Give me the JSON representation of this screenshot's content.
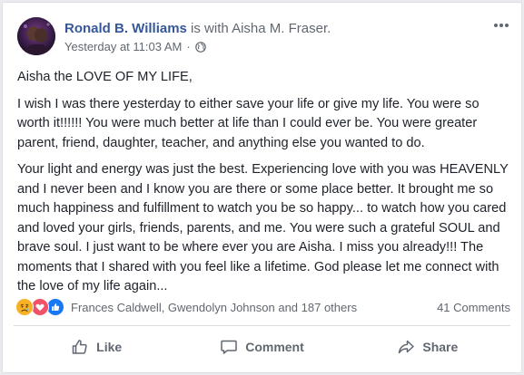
{
  "post": {
    "author": "Ronald B. Williams",
    "with_text": " is with ",
    "tagged": "Aisha M. Fraser.",
    "timestamp": "Yesterday at 11:03 AM",
    "separator": "·",
    "privacy_icon": "globe-icon",
    "more_icon": "more-options-icon",
    "paragraphs": [
      "Aisha the LOVE OF MY LIFE,",
      "I wish I was there yesterday to either save your life or give my life. You were so worth it!!!!!! You were much better at life than I could ever be. You were greater parent, friend, daughter, teacher, and anything else you wanted to do.",
      "Your light and energy was just the best. Experiencing love with you was HEAVENLY and I never been and I know you are there or some place better. It brought me so much happiness and fulfillment to watch you be so happy... to watch how you cared and loved your girls, friends, parents, and me. You were such a grateful SOUL and brave soul. I just want to be where ever you are Aisha. I miss you already!!! The moments that I shared with you feel like a lifetime. God please let me connect with the love of my life again..."
    ]
  },
  "reactions": {
    "icons": [
      "sad-reaction-icon",
      "love-reaction-icon",
      "like-reaction-icon"
    ],
    "colors": {
      "sad": "#f7b125",
      "love": "#f25268",
      "like": "#1877f2"
    },
    "summary": "Frances Caldwell, Gwendolyn Johnson and 187 others",
    "comments": "41 Comments"
  },
  "actions": {
    "like": "Like",
    "comment": "Comment",
    "share": "Share"
  },
  "colors": {
    "author_link": "#365899",
    "secondary_text": "#616770",
    "body_text": "#1d2129",
    "page_background": "#e9ebee"
  }
}
